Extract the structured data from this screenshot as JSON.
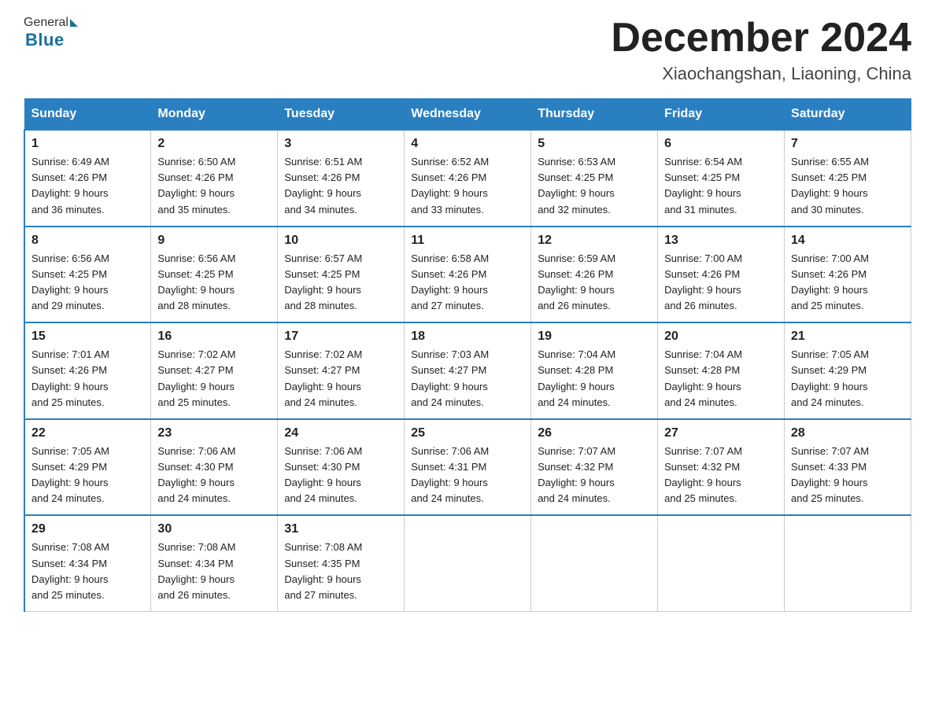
{
  "header": {
    "logo_general": "General",
    "logo_blue": "Blue",
    "month_title": "December 2024",
    "location": "Xiaochangshan, Liaoning, China"
  },
  "days_of_week": [
    "Sunday",
    "Monday",
    "Tuesday",
    "Wednesday",
    "Thursday",
    "Friday",
    "Saturday"
  ],
  "weeks": [
    [
      {
        "day": "1",
        "sunrise": "6:49 AM",
        "sunset": "4:26 PM",
        "daylight": "9 hours and 36 minutes."
      },
      {
        "day": "2",
        "sunrise": "6:50 AM",
        "sunset": "4:26 PM",
        "daylight": "9 hours and 35 minutes."
      },
      {
        "day": "3",
        "sunrise": "6:51 AM",
        "sunset": "4:26 PM",
        "daylight": "9 hours and 34 minutes."
      },
      {
        "day": "4",
        "sunrise": "6:52 AM",
        "sunset": "4:26 PM",
        "daylight": "9 hours and 33 minutes."
      },
      {
        "day": "5",
        "sunrise": "6:53 AM",
        "sunset": "4:25 PM",
        "daylight": "9 hours and 32 minutes."
      },
      {
        "day": "6",
        "sunrise": "6:54 AM",
        "sunset": "4:25 PM",
        "daylight": "9 hours and 31 minutes."
      },
      {
        "day": "7",
        "sunrise": "6:55 AM",
        "sunset": "4:25 PM",
        "daylight": "9 hours and 30 minutes."
      }
    ],
    [
      {
        "day": "8",
        "sunrise": "6:56 AM",
        "sunset": "4:25 PM",
        "daylight": "9 hours and 29 minutes."
      },
      {
        "day": "9",
        "sunrise": "6:56 AM",
        "sunset": "4:25 PM",
        "daylight": "9 hours and 28 minutes."
      },
      {
        "day": "10",
        "sunrise": "6:57 AM",
        "sunset": "4:25 PM",
        "daylight": "9 hours and 28 minutes."
      },
      {
        "day": "11",
        "sunrise": "6:58 AM",
        "sunset": "4:26 PM",
        "daylight": "9 hours and 27 minutes."
      },
      {
        "day": "12",
        "sunrise": "6:59 AM",
        "sunset": "4:26 PM",
        "daylight": "9 hours and 26 minutes."
      },
      {
        "day": "13",
        "sunrise": "7:00 AM",
        "sunset": "4:26 PM",
        "daylight": "9 hours and 26 minutes."
      },
      {
        "day": "14",
        "sunrise": "7:00 AM",
        "sunset": "4:26 PM",
        "daylight": "9 hours and 25 minutes."
      }
    ],
    [
      {
        "day": "15",
        "sunrise": "7:01 AM",
        "sunset": "4:26 PM",
        "daylight": "9 hours and 25 minutes."
      },
      {
        "day": "16",
        "sunrise": "7:02 AM",
        "sunset": "4:27 PM",
        "daylight": "9 hours and 25 minutes."
      },
      {
        "day": "17",
        "sunrise": "7:02 AM",
        "sunset": "4:27 PM",
        "daylight": "9 hours and 24 minutes."
      },
      {
        "day": "18",
        "sunrise": "7:03 AM",
        "sunset": "4:27 PM",
        "daylight": "9 hours and 24 minutes."
      },
      {
        "day": "19",
        "sunrise": "7:04 AM",
        "sunset": "4:28 PM",
        "daylight": "9 hours and 24 minutes."
      },
      {
        "day": "20",
        "sunrise": "7:04 AM",
        "sunset": "4:28 PM",
        "daylight": "9 hours and 24 minutes."
      },
      {
        "day": "21",
        "sunrise": "7:05 AM",
        "sunset": "4:29 PM",
        "daylight": "9 hours and 24 minutes."
      }
    ],
    [
      {
        "day": "22",
        "sunrise": "7:05 AM",
        "sunset": "4:29 PM",
        "daylight": "9 hours and 24 minutes."
      },
      {
        "day": "23",
        "sunrise": "7:06 AM",
        "sunset": "4:30 PM",
        "daylight": "9 hours and 24 minutes."
      },
      {
        "day": "24",
        "sunrise": "7:06 AM",
        "sunset": "4:30 PM",
        "daylight": "9 hours and 24 minutes."
      },
      {
        "day": "25",
        "sunrise": "7:06 AM",
        "sunset": "4:31 PM",
        "daylight": "9 hours and 24 minutes."
      },
      {
        "day": "26",
        "sunrise": "7:07 AM",
        "sunset": "4:32 PM",
        "daylight": "9 hours and 24 minutes."
      },
      {
        "day": "27",
        "sunrise": "7:07 AM",
        "sunset": "4:32 PM",
        "daylight": "9 hours and 25 minutes."
      },
      {
        "day": "28",
        "sunrise": "7:07 AM",
        "sunset": "4:33 PM",
        "daylight": "9 hours and 25 minutes."
      }
    ],
    [
      {
        "day": "29",
        "sunrise": "7:08 AM",
        "sunset": "4:34 PM",
        "daylight": "9 hours and 25 minutes."
      },
      {
        "day": "30",
        "sunrise": "7:08 AM",
        "sunset": "4:34 PM",
        "daylight": "9 hours and 26 minutes."
      },
      {
        "day": "31",
        "sunrise": "7:08 AM",
        "sunset": "4:35 PM",
        "daylight": "9 hours and 27 minutes."
      },
      null,
      null,
      null,
      null
    ]
  ],
  "labels": {
    "sunrise": "Sunrise:",
    "sunset": "Sunset:",
    "daylight": "Daylight:"
  }
}
